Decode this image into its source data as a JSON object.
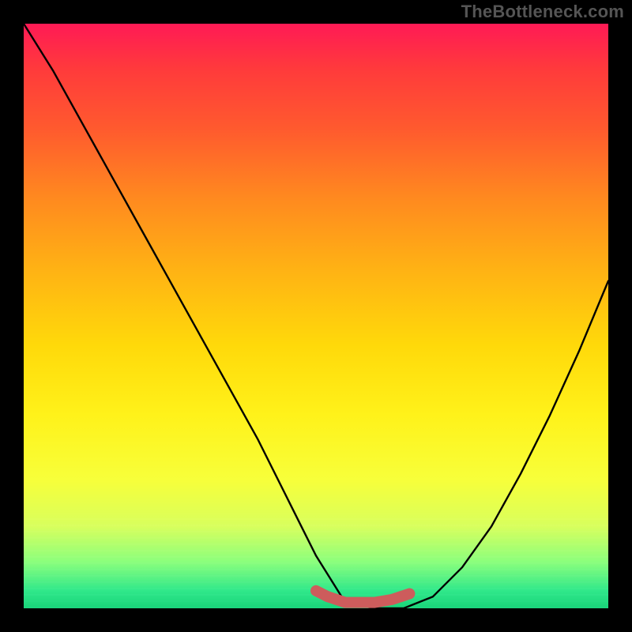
{
  "watermark": "TheBottleneck.com",
  "chart_data": {
    "type": "line",
    "title": "",
    "xlabel": "",
    "ylabel": "",
    "xlim": [
      0,
      100
    ],
    "ylim": [
      0,
      100
    ],
    "grid": false,
    "legend": false,
    "series": [
      {
        "name": "curve",
        "color": "#000000",
        "x": [
          0,
          5,
          10,
          15,
          20,
          25,
          30,
          35,
          40,
          45,
          50,
          55,
          60,
          65,
          70,
          75,
          80,
          85,
          90,
          95,
          100
        ],
        "y": [
          100,
          92,
          83,
          74,
          65,
          56,
          47,
          38,
          29,
          19,
          9,
          1,
          0,
          0,
          2,
          7,
          14,
          23,
          33,
          44,
          56
        ]
      },
      {
        "name": "trough-marker",
        "color": "#cd5c5c",
        "x": [
          50,
          52,
          55,
          58,
          60,
          63,
          66
        ],
        "y": [
          3,
          2,
          1,
          1,
          1,
          1.5,
          2.5
        ]
      }
    ],
    "colors": {
      "gradient_top": "#ff1a55",
      "gradient_bottom": "#19d47a",
      "frame": "#000000",
      "watermark": "#555555"
    }
  }
}
